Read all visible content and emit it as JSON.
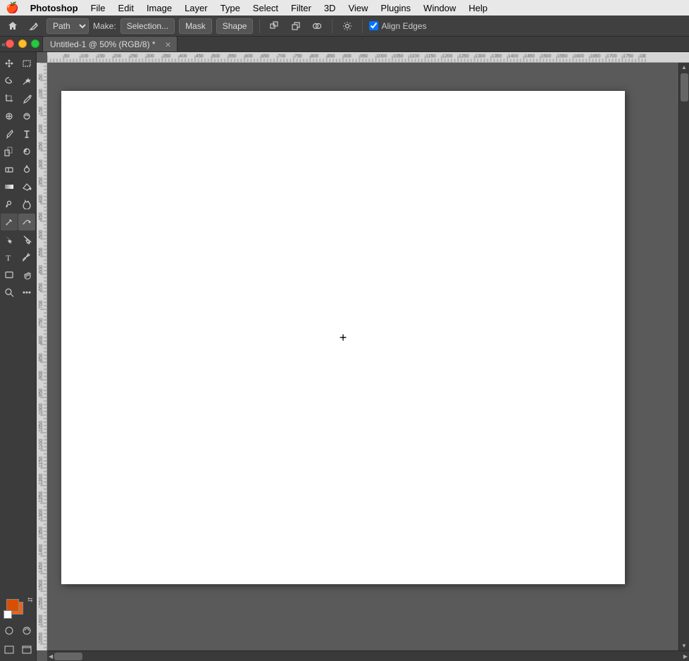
{
  "menubar": {
    "apple": "🍎",
    "app_name": "Photoshop",
    "items": [
      "File",
      "Edit",
      "Image",
      "Layer",
      "Type",
      "Select",
      "Filter",
      "3D",
      "View",
      "Plugins",
      "Window",
      "Help"
    ]
  },
  "options_bar": {
    "tool_label": "Path",
    "make_label": "Make:",
    "selection_btn": "Selection...",
    "mask_btn": "Mask",
    "shape_btn": "Shape",
    "align_edges_label": "Align Edges",
    "icons": [
      "home-icon",
      "pen-options-icon",
      "path-ops-icon",
      "path-arrange-icon",
      "path-combine-icon",
      "gear-icon"
    ]
  },
  "tab": {
    "title": "Untitled-1 @ 50% (RGB/8) *"
  },
  "window_controls": {
    "close": "close",
    "minimize": "minimize",
    "maximize": "maximize"
  },
  "toolbox": {
    "tools": [
      {
        "id": "move",
        "icon": "✛",
        "label": "Move Tool"
      },
      {
        "id": "select-rect",
        "icon": "⬚",
        "label": "Rectangular Marquee"
      },
      {
        "id": "lasso",
        "icon": "⌒",
        "label": "Lasso Tool"
      },
      {
        "id": "magic-wand",
        "icon": "✦",
        "label": "Magic Wand"
      },
      {
        "id": "crop",
        "icon": "⌗",
        "label": "Crop Tool"
      },
      {
        "id": "eyedropper",
        "icon": "✒",
        "label": "Eyedropper"
      },
      {
        "id": "heal",
        "icon": "✚",
        "label": "Healing Brush"
      },
      {
        "id": "brush",
        "icon": "✏",
        "label": "Brush Tool"
      },
      {
        "id": "clone-stamp",
        "icon": "✦",
        "label": "Clone Stamp"
      },
      {
        "id": "eraser",
        "icon": "◻",
        "label": "Eraser"
      },
      {
        "id": "gradient",
        "icon": "▭",
        "label": "Gradient Tool"
      },
      {
        "id": "dodge",
        "icon": "◑",
        "label": "Dodge Tool"
      },
      {
        "id": "pen",
        "icon": "✒",
        "label": "Pen Tool",
        "active": true
      },
      {
        "id": "type",
        "icon": "T",
        "label": "Type Tool"
      },
      {
        "id": "path-select",
        "icon": "↖",
        "label": "Path Selection"
      },
      {
        "id": "shape",
        "icon": "▭",
        "label": "Shape Tool"
      },
      {
        "id": "hand",
        "icon": "✋",
        "label": "Hand Tool"
      },
      {
        "id": "zoom",
        "icon": "⌕",
        "label": "Zoom Tool"
      },
      {
        "id": "more",
        "icon": "···",
        "label": "More Tools"
      }
    ],
    "fg_color": "#d94f00",
    "bg_color": "#e8641a"
  },
  "rulers": {
    "h_ticks": [
      0,
      50,
      100,
      150,
      200,
      250,
      300,
      350,
      400,
      450,
      500,
      550,
      600,
      650,
      700,
      750,
      800,
      850,
      900,
      950,
      1000,
      1050,
      1100,
      1150,
      1200,
      1250,
      1300,
      1350,
      1400,
      1450,
      1500,
      1600,
      1700
    ],
    "v_ticks": [
      0,
      50,
      100,
      150,
      200,
      250,
      300,
      400,
      500,
      600,
      700,
      800,
      900
    ]
  },
  "canvas": {
    "zoom": "50%",
    "color_mode": "RGB/8",
    "doc_name": "Untitled-1"
  }
}
